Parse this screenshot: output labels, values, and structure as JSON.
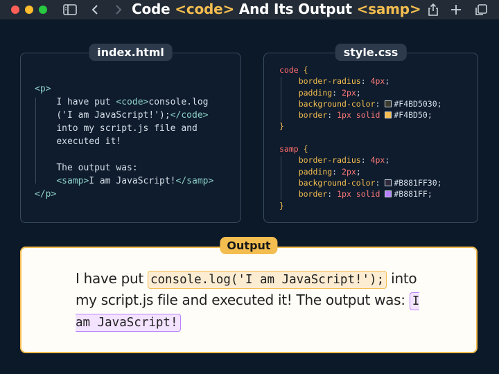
{
  "window": {
    "title_prefix": "Code ",
    "title_tag1": "<code>",
    "title_middle": " And Its Output ",
    "title_tag2": "<samp>"
  },
  "html_panel": {
    "label": "index.html",
    "lines": [
      {
        "tag": "<p>",
        "text": ""
      },
      {
        "tag": "",
        "text": "I have put ",
        "tag2": "<code>",
        "rest": "console.log"
      },
      {
        "tag": "",
        "text": "('I am JavaScript!');",
        "tag2": "</code>",
        "rest": ""
      },
      {
        "tag": "",
        "text": "into my script.js file and"
      },
      {
        "tag": "",
        "text": "executed it!"
      },
      {
        "tag": "",
        "text": ""
      },
      {
        "tag": "",
        "text": "The output was:"
      },
      {
        "tag": "<samp>",
        "text": "I am JavaScript!",
        "tag2": "</samp>"
      },
      {
        "tag": "</p>",
        "text": ""
      }
    ]
  },
  "css_panel": {
    "label": "style.css",
    "rules": [
      {
        "selector": "code",
        "decls": [
          {
            "prop": "border-radius",
            "value": "4px"
          },
          {
            "prop": "padding",
            "value": "2px"
          },
          {
            "prop": "background-color",
            "value": "#F4BD5030",
            "swatch": "#3a3a2e"
          },
          {
            "prop": "border",
            "value_pre": "1px solid ",
            "value": "#F4BD50",
            "swatch": "#f4bd50"
          }
        ]
      },
      {
        "selector": "samp",
        "decls": [
          {
            "prop": "border-radius",
            "value": "4px"
          },
          {
            "prop": "padding",
            "value": "2px"
          },
          {
            "prop": "background-color",
            "value": "#B881FF30",
            "swatch": "#2e2a3c"
          },
          {
            "prop": "border",
            "value_pre": "1px solid ",
            "value": "#B881FF",
            "swatch": "#b881ff"
          }
        ]
      }
    ]
  },
  "output": {
    "label": "Output",
    "text_before": "I have put ",
    "code": "console.log('I am JavaScript!');",
    "text_middle": " into my script.js file and executed it! The output was: ",
    "samp": "I am JavaScript!"
  }
}
